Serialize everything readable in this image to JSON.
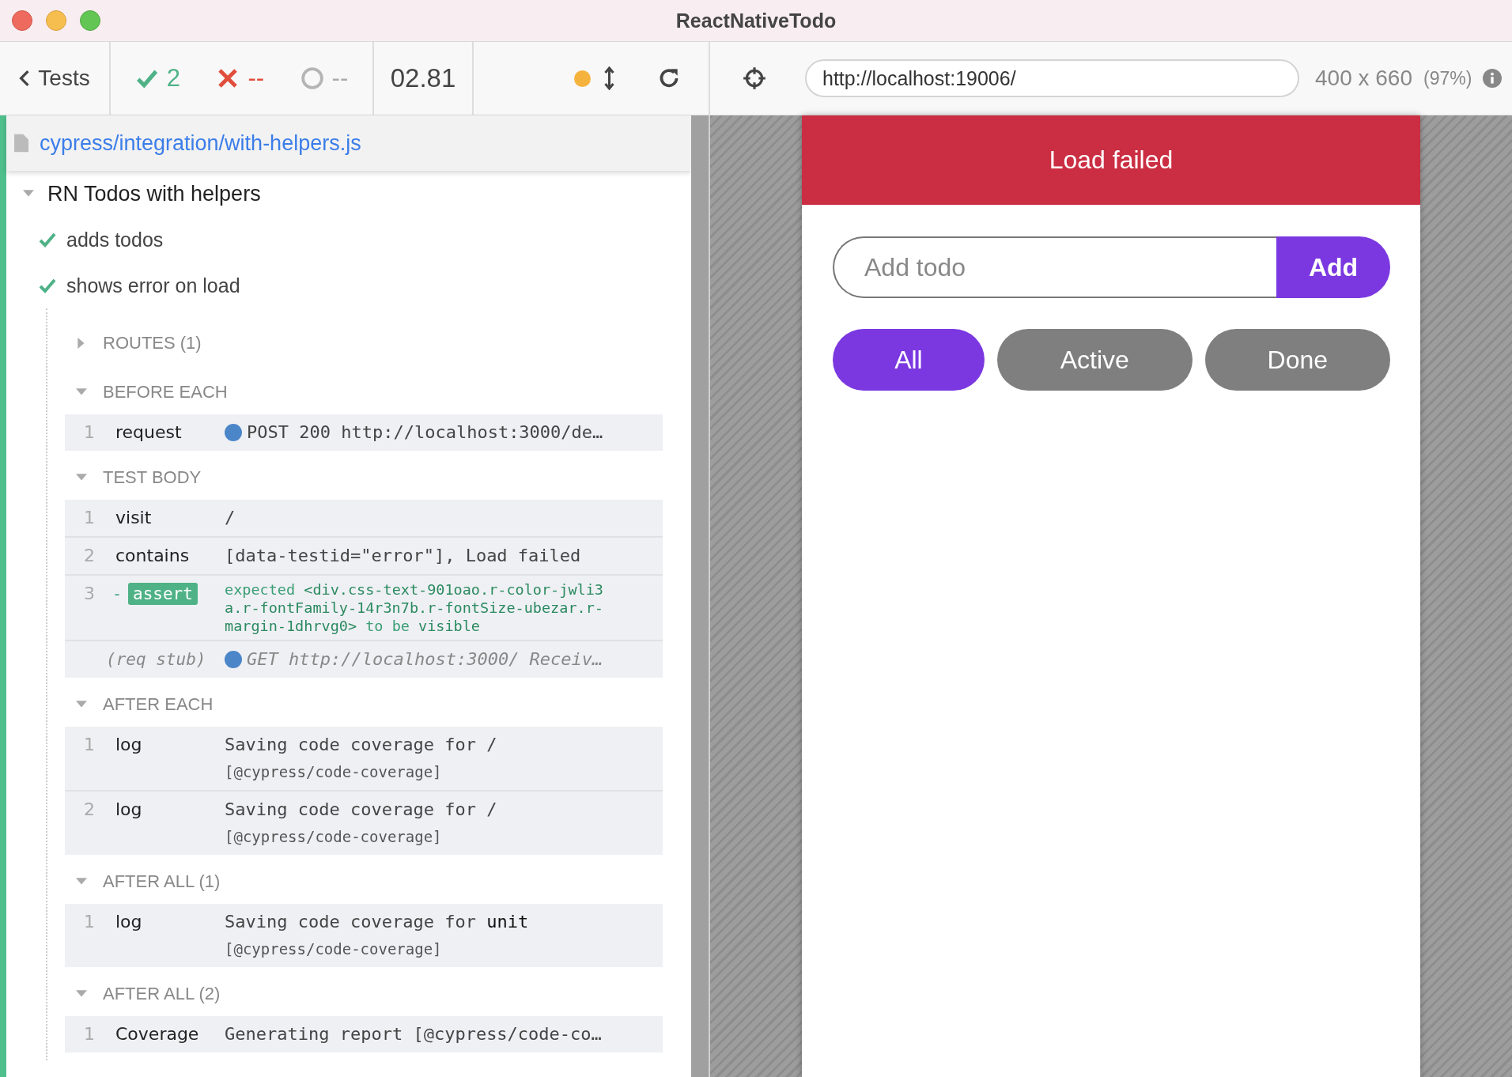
{
  "window": {
    "title": "ReactNativeTodo"
  },
  "toolbar": {
    "back": "Tests",
    "passed": "2",
    "failed": "--",
    "pending": "--",
    "duration": "02.81",
    "url": "http://localhost:19006/",
    "viewport": "400 x 660",
    "scale": "(97%)"
  },
  "spec_file": "cypress/integration/with-helpers.js",
  "suite": {
    "title": "RN Todos with helpers",
    "expanded": true,
    "tests": [
      {
        "title": "adds todos",
        "passed": true
      },
      {
        "title": "shows error on load",
        "passed": true
      }
    ]
  },
  "sections": [
    {
      "title": "ROUTES (1)",
      "expanded": false
    },
    {
      "title": "BEFORE EACH",
      "expanded": true,
      "commands": [
        {
          "kind": "command",
          "number": "1",
          "name": "request",
          "message": "POST 200 http://localhost:3000/de…",
          "color": "#4a86c8"
        }
      ]
    },
    {
      "title": "TEST BODY",
      "expanded": true,
      "commands": [
        {
          "kind": "command",
          "number": "1",
          "name": "visit",
          "message": "/"
        },
        {
          "kind": "command",
          "number": "2",
          "name": "contains",
          "message": "[data-testid=\"error\"], Load failed"
        },
        {
          "kind": "assert",
          "number": "3",
          "prefix": "-",
          "name": "assert",
          "message": "expected **<div.css-text-901oao.r-color-jwli3a.r-fontFamily-14r3n7b.r-fontSize-ubezar.r-margin-1dhrvg0>** to be **visible**"
        },
        {
          "kind": "stub",
          "name": "(req stub)",
          "message": "GET http://localhost:3000/ Receiv…",
          "color": "#4a86c8"
        }
      ]
    },
    {
      "title": "AFTER EACH",
      "expanded": true,
      "commands": [
        {
          "kind": "command",
          "number": "1",
          "name": "log",
          "message": "Saving code coverage for /",
          "detail": "[@cypress/code-coverage]"
        },
        {
          "kind": "command",
          "number": "2",
          "name": "log",
          "message": "Saving code coverage for /",
          "detail": "[@cypress/code-coverage]"
        }
      ]
    },
    {
      "title": "AFTER ALL (1)",
      "expanded": true,
      "commands": [
        {
          "kind": "command",
          "number": "1",
          "name": "log",
          "message": "Saving code coverage for **unit**",
          "detail": "[@cypress/code-coverage]"
        }
      ]
    },
    {
      "title": "AFTER ALL (2)",
      "expanded": true,
      "commands": [
        {
          "kind": "command",
          "number": "1",
          "name": "Coverage",
          "message": "Generating report [@cypress/code-co…"
        }
      ]
    }
  ],
  "app": {
    "error": "Load failed",
    "input": {
      "placeholder": "Add todo"
    },
    "add_button": "Add",
    "filters": [
      {
        "label": "All",
        "selected": true
      },
      {
        "label": "Active",
        "selected": false
      },
      {
        "label": "Done",
        "selected": false
      }
    ]
  }
}
